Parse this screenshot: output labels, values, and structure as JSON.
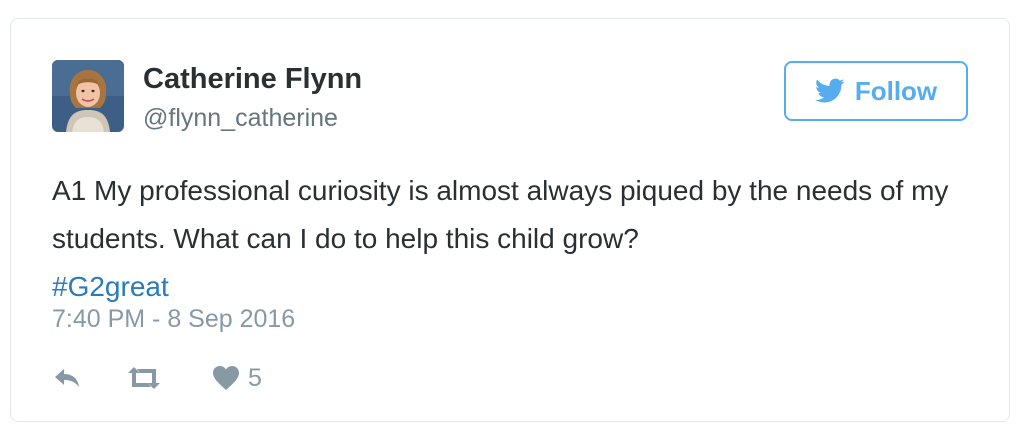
{
  "tweet": {
    "author": {
      "name": "Catherine Flynn",
      "handle": "@flynn_catherine",
      "avatar_icon": "profile-photo"
    },
    "follow_label": "Follow",
    "text": "A1 My professional curiosity is almost always piqued by the needs of my students. What can I do to help this child grow?",
    "hashtag": "#G2great",
    "timestamp": "7:40 PM - 8 Sep 2016",
    "actions": {
      "reply_icon": "reply-icon",
      "retweet_icon": "retweet-icon",
      "like_icon": "heart-icon",
      "like_count": "5"
    }
  },
  "colors": {
    "accent": "#55acee",
    "link": "#2b7bb9",
    "text": "#292f33",
    "muted": "#66757f",
    "meta": "#8899a6",
    "border": "#e1e8ed"
  }
}
